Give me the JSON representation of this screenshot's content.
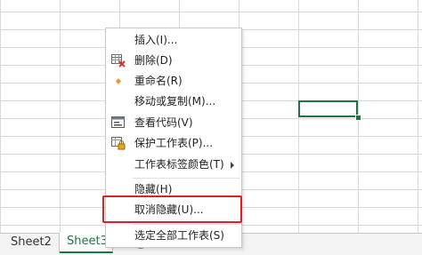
{
  "context_menu": {
    "items": [
      {
        "label": "插入(I)...",
        "icon": "none"
      },
      {
        "label": "删除(D)",
        "icon": "delete-sheet-icon"
      },
      {
        "label": "重命名(R)",
        "icon": "diamond-bullet-icon"
      },
      {
        "label": "移动或复制(M)...",
        "icon": "none"
      },
      {
        "label": "查看代码(V)",
        "icon": "view-code-icon"
      },
      {
        "label": "保护工作表(P)...",
        "icon": "protect-sheet-icon"
      },
      {
        "label": "工作表标签颜色(T)",
        "icon": "none",
        "submenu": true
      },
      {
        "label": "隐藏(H)",
        "icon": "none"
      },
      {
        "label": "取消隐藏(U)...",
        "icon": "none",
        "highlighted": true
      },
      {
        "label": "选定全部工作表(S)",
        "icon": "none"
      }
    ],
    "highlight_color": "#e02020"
  },
  "sheet_tabs": {
    "tabs": [
      "Sheet2",
      "Sheet3"
    ],
    "active": "Sheet3",
    "add_icon": "plus-circle-icon"
  },
  "colors": {
    "accent": "#217346",
    "highlight": "#e02020"
  }
}
